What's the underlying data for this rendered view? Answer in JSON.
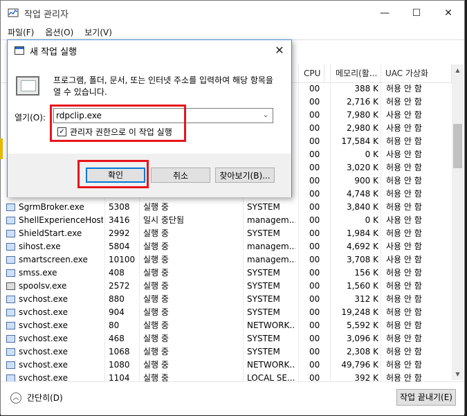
{
  "window": {
    "title": "작업 관리자",
    "minimize": "—",
    "maximize": "☐",
    "close": "✕"
  },
  "menu": [
    "파일(F)",
    "옵션(O)",
    "보기(V)"
  ],
  "columns": {
    "cpu": "CPU",
    "mem": "메모리(활...",
    "uac": "UAC 가상화"
  },
  "hidden_rows": [
    {
      "cpu": "00",
      "mem": "388 K",
      "uac": "허용 안 함"
    },
    {
      "cpu": "00",
      "mem": "2,716 K",
      "uac": "허용 안 함"
    },
    {
      "cpu": "00",
      "mem": "7,980 K",
      "uac": "사용 안 함"
    },
    {
      "cpu": "00",
      "mem": "2,980 K",
      "uac": "사용 안 함"
    },
    {
      "cpu": "00",
      "mem": "17,584 K",
      "uac": "허용 안 함"
    },
    {
      "cpu": "00",
      "mem": "0 K",
      "uac": "사용 안 함"
    },
    {
      "cpu": "00",
      "mem": "3,020 K",
      "uac": "허용 안 함"
    },
    {
      "cpu": "00",
      "mem": "900 K",
      "uac": "허용 안 함"
    },
    {
      "cpu": "00",
      "mem": "4,748 K",
      "uac": "허용 안 함"
    }
  ],
  "rows": [
    {
      "name": "SgrmBroker.exe",
      "pid": "5308",
      "status": "실행 중",
      "user": "SYSTEM",
      "cpu": "00",
      "mem": "3,840 K",
      "uac": "허용 안 함"
    },
    {
      "name": "ShellExperienceHost...",
      "pid": "3416",
      "status": "일시 중단됨",
      "user": "managem...",
      "cpu": "00",
      "mem": "0 K",
      "uac": "사용 안 함"
    },
    {
      "name": "ShieldStart.exe",
      "pid": "2992",
      "status": "실행 중",
      "user": "SYSTEM",
      "cpu": "00",
      "mem": "1,984 K",
      "uac": "허용 안 함"
    },
    {
      "name": "sihost.exe",
      "pid": "5804",
      "status": "실행 중",
      "user": "managem...",
      "cpu": "00",
      "mem": "4,692 K",
      "uac": "사용 안 함"
    },
    {
      "name": "smartscreen.exe",
      "pid": "10100",
      "status": "실행 중",
      "user": "managem...",
      "cpu": "00",
      "mem": "3,708 K",
      "uac": "사용 안 함"
    },
    {
      "name": "smss.exe",
      "pid": "408",
      "status": "실행 중",
      "user": "SYSTEM",
      "cpu": "00",
      "mem": "156 K",
      "uac": "허용 안 함"
    },
    {
      "name": "spoolsv.exe",
      "pid": "2572",
      "status": "실행 중",
      "user": "SYSTEM",
      "cpu": "00",
      "mem": "1,560 K",
      "uac": "허용 안 함",
      "icon": "printer"
    },
    {
      "name": "svchost.exe",
      "pid": "880",
      "status": "실행 중",
      "user": "SYSTEM",
      "cpu": "00",
      "mem": "312 K",
      "uac": "허용 안 함"
    },
    {
      "name": "svchost.exe",
      "pid": "904",
      "status": "실행 중",
      "user": "SYSTEM",
      "cpu": "00",
      "mem": "19,248 K",
      "uac": "허용 안 함"
    },
    {
      "name": "svchost.exe",
      "pid": "80",
      "status": "실행 중",
      "user": "NETWORK...",
      "cpu": "00",
      "mem": "5,592 K",
      "uac": "허용 안 함"
    },
    {
      "name": "svchost.exe",
      "pid": "468",
      "status": "실행 중",
      "user": "SYSTEM",
      "cpu": "00",
      "mem": "3,096 K",
      "uac": "허용 안 함"
    },
    {
      "name": "svchost.exe",
      "pid": "1068",
      "status": "실행 중",
      "user": "SYSTEM",
      "cpu": "00",
      "mem": "2,308 K",
      "uac": "허용 안 함"
    },
    {
      "name": "svchost.exe",
      "pid": "1080",
      "status": "실행 중",
      "user": "NETWORK...",
      "cpu": "00",
      "mem": "49,796 K",
      "uac": "허용 안 함"
    },
    {
      "name": "svchost.exe",
      "pid": "1104",
      "status": "실행 중",
      "user": "LOCAL SE...",
      "cpu": "00",
      "mem": "392 K",
      "uac": "허용 안 함"
    }
  ],
  "footer": {
    "fewer_details": "간단히(D)",
    "end_task": "작업 끝내기(E)"
  },
  "run_dialog": {
    "title": "새 작업 실행",
    "close": "✕",
    "description": "프로그램, 폴더, 문서, 또는 인터넷 주소를 입력하여 해당 항목을 열 수 있습니다.",
    "open_label": "열기(O):",
    "open_value": "rdpclip.exe",
    "admin_checkbox_label": "관리자 권한으로 이 작업 실행",
    "admin_checked": true,
    "ok": "확인",
    "cancel": "취소",
    "browse": "찾아보기(B)..."
  },
  "colors": {
    "highlight": "#e8141c",
    "accent": "#0078d7"
  }
}
